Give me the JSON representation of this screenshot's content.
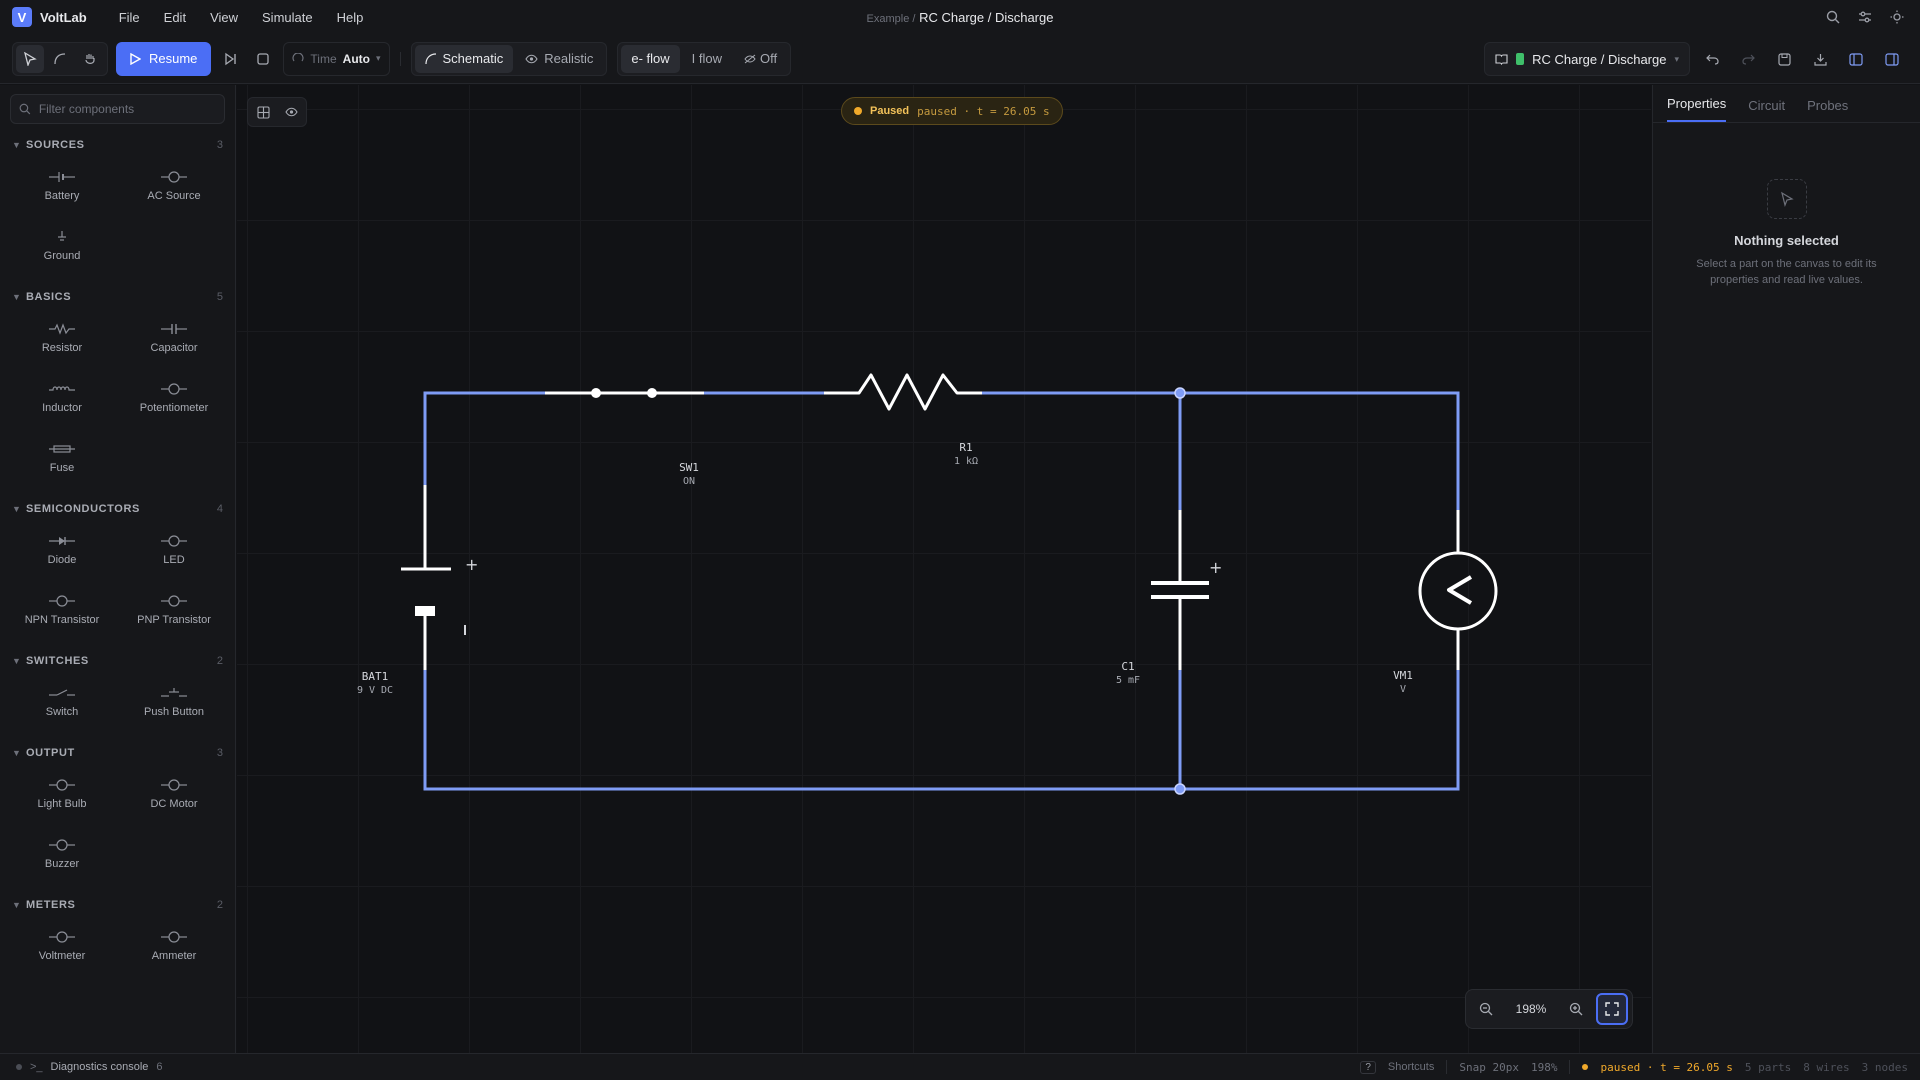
{
  "app": {
    "name": "VoltLab",
    "logo_letter": "V",
    "accent": "#4b6ef5"
  },
  "menu": [
    "File",
    "Edit",
    "View",
    "Simulate",
    "Help"
  ],
  "document": {
    "crumb": "Example /",
    "title": "RC Charge / Discharge"
  },
  "toolbar": {
    "resume_label": "Resume",
    "time_label": "Time",
    "time_value": "Auto",
    "view_modes": [
      "Schematic",
      "Realistic"
    ],
    "flow_modes": [
      "e- flow",
      "I flow",
      "Off"
    ],
    "project_name": "RC Charge / Discharge"
  },
  "left_panel": {
    "filter_placeholder": "Filter components",
    "sections": [
      {
        "title": "SOURCES",
        "count": "3",
        "items": [
          "Battery",
          "AC Source",
          "Ground"
        ]
      },
      {
        "title": "BASICS",
        "count": "5",
        "items": [
          "Resistor",
          "Capacitor",
          "Inductor",
          "Potentiometer",
          "Fuse"
        ]
      },
      {
        "title": "SEMICONDUCTORS",
        "count": "4",
        "items": [
          "Diode",
          "LED",
          "NPN Transistor",
          "PNP Transistor"
        ]
      },
      {
        "title": "SWITCHES",
        "count": "2",
        "items": [
          "Switch",
          "Push Button"
        ]
      },
      {
        "title": "OUTPUT",
        "count": "3",
        "items": [
          "Light Bulb",
          "DC Motor",
          "Buzzer"
        ]
      },
      {
        "title": "METERS",
        "count": "2",
        "items": [
          "Voltmeter",
          "Ammeter"
        ]
      }
    ]
  },
  "canvas": {
    "status_label": "Paused",
    "status_detail": "paused · t = 26.05 s",
    "zoom": "198%",
    "wire_color": "#7f9cf5",
    "parts": {
      "sw1": {
        "name": "SW1",
        "value": "ON"
      },
      "r1": {
        "name": "R1",
        "value": "1 kΩ"
      },
      "bat1": {
        "name": "BAT1",
        "value": "9 V DC"
      },
      "c1": {
        "name": "C1",
        "value": "5 mF"
      },
      "vm1": {
        "name": "VM1",
        "value": "V"
      }
    }
  },
  "right_panel": {
    "tabs": [
      "Properties",
      "Circuit",
      "Probes"
    ],
    "empty_title": "Nothing selected",
    "empty_desc": "Select a part on the canvas to edit its properties and read live values."
  },
  "status_bar": {
    "console_label": "Diagnostics console",
    "console_count": "6",
    "shortcuts_key": "?",
    "shortcuts_label": "Shortcuts",
    "snap": "Snap 20px",
    "zoom": "198%",
    "sim_state": "paused · t = 26.05 s",
    "parts": "5 parts",
    "wires": "8 wires",
    "nodes": "3 nodes"
  }
}
